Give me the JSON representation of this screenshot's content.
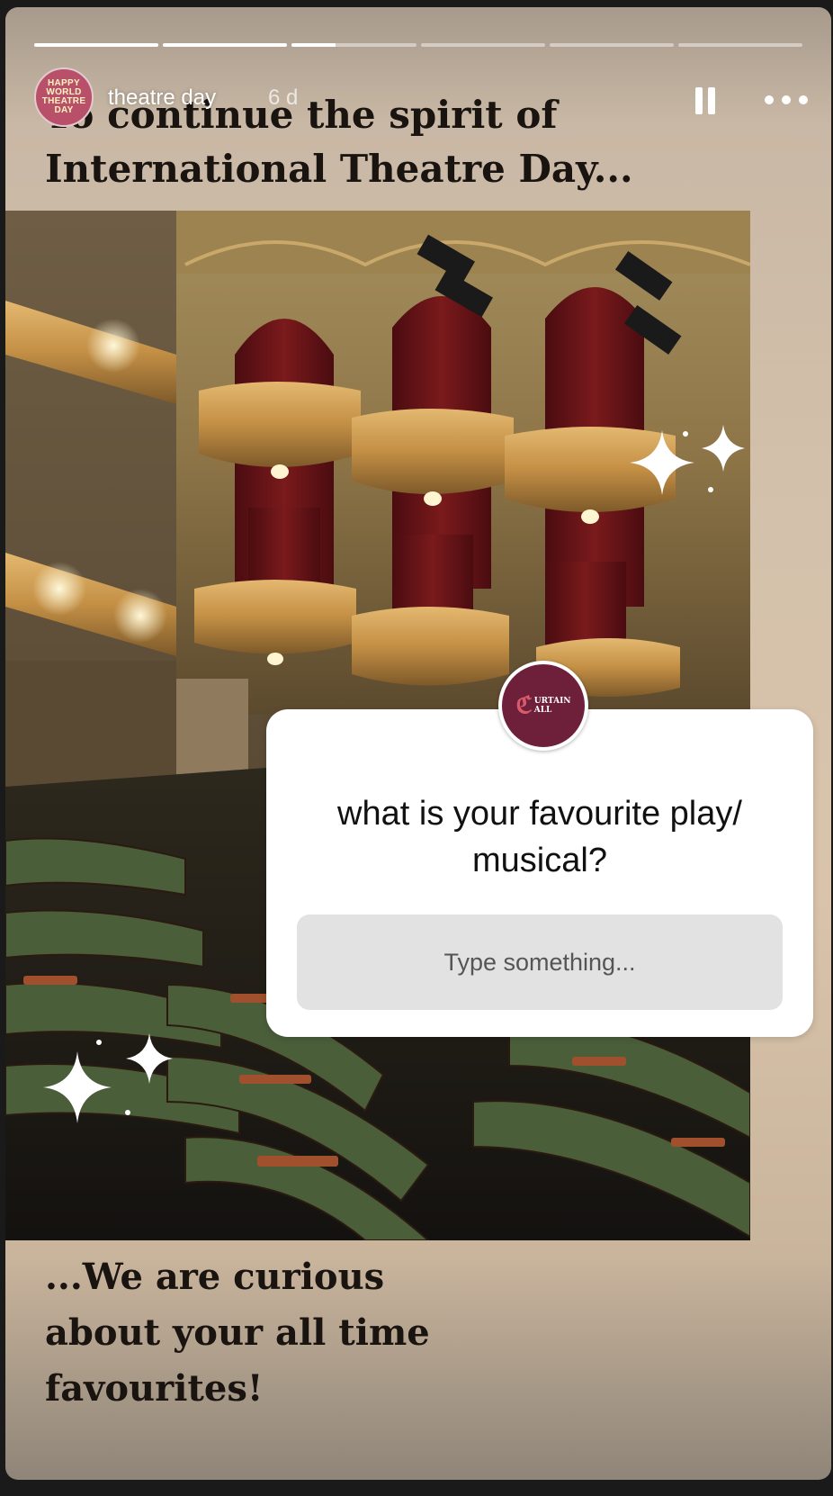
{
  "story": {
    "progress": [
      1,
      1,
      0.35,
      0,
      0,
      0
    ],
    "user": {
      "avatar_text": [
        "HAPPY",
        "WORLD",
        "THEATRE",
        "DAY"
      ],
      "name": "theatre day",
      "time": "6 d"
    },
    "controls": {
      "pause_icon": "pause-icon",
      "more_icon": "more-icon"
    }
  },
  "content": {
    "headline_line1": "To continue the spirit of",
    "headline_line2": "International Theatre Day...",
    "footer_line1": "...We are curious",
    "footer_line2": "about your all time",
    "footer_line3": "favourites!"
  },
  "question_sticker": {
    "logo_mark": "ℭ",
    "logo_text_1": "URTAIN",
    "logo_text_2": "ALL",
    "question": "what is your favourite play/ musical?",
    "placeholder": "Type something..."
  },
  "colors": {
    "logo_bg": "#6e1f3a",
    "avatar_bg": "#b8506a"
  }
}
